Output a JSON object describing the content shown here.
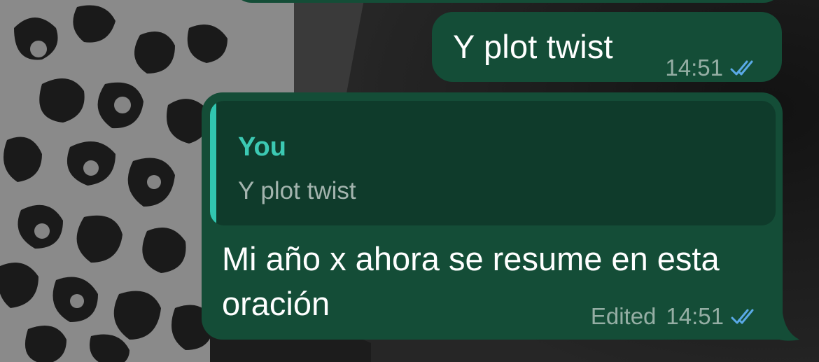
{
  "chat": {
    "messages": [
      {
        "text": "Y plot twist",
        "time": "14:51",
        "status_icon": "double-check-read-icon"
      },
      {
        "reply_to": {
          "author": "You",
          "text": "Y plot twist"
        },
        "text": "Mi año x ahora se resume en esta oración",
        "edited_label": "Edited",
        "time": "14:51",
        "status_icon": "double-check-read-icon"
      }
    ]
  },
  "colors": {
    "bubble_outgoing": "#144d37",
    "quote_background": "#0f3b2b",
    "quote_accent": "#31c6b0",
    "read_ticks": "#5aa9e6",
    "meta_text": "rgba(255,255,255,0.55)"
  }
}
